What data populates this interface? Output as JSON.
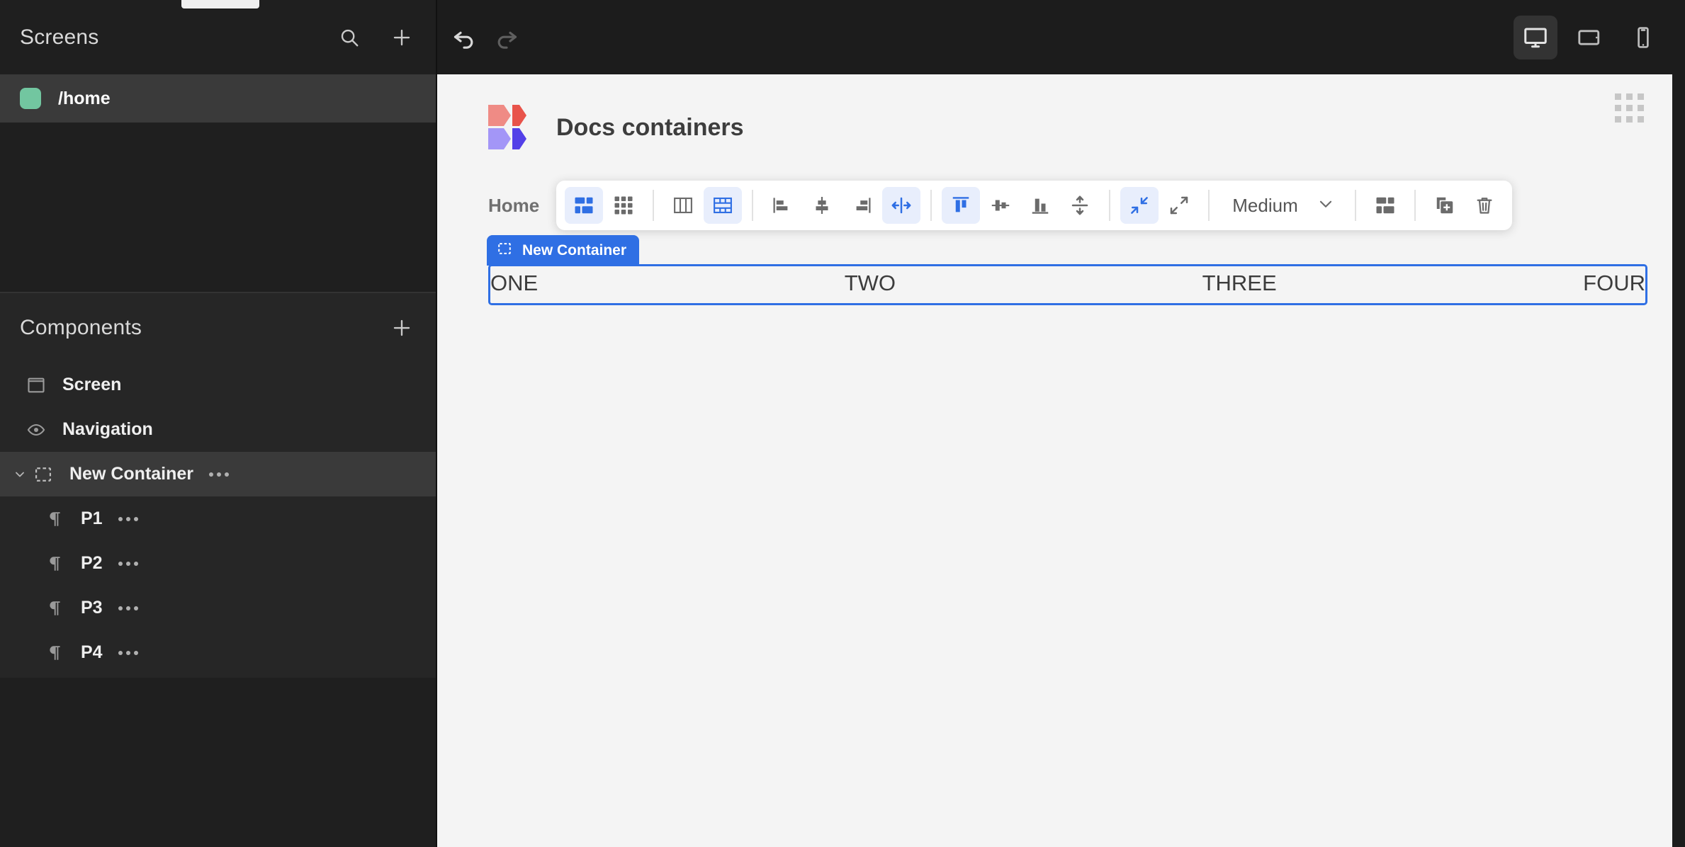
{
  "sidebar": {
    "screens_panel": {
      "title": "Screens",
      "search_icon": "search-icon",
      "add_icon": "plus-icon",
      "items": [
        {
          "label": "/home",
          "dot_color": "#72c6a0",
          "selected": true
        }
      ]
    },
    "components_panel": {
      "title": "Components",
      "add_icon": "plus-icon",
      "tree": [
        {
          "label": "Screen",
          "icon": "screen-icon",
          "level": 0,
          "selected": false,
          "has_menu": false,
          "has_chevron": false
        },
        {
          "label": "Navigation",
          "icon": "eye-icon",
          "level": 0,
          "selected": false,
          "has_menu": false,
          "has_chevron": false
        },
        {
          "label": "New Container",
          "icon": "container-icon",
          "level": 0,
          "selected": true,
          "has_menu": true,
          "has_chevron": true
        },
        {
          "label": "P1",
          "icon": "paragraph-icon",
          "level": 1,
          "selected": false,
          "has_menu": true,
          "has_chevron": false
        },
        {
          "label": "P2",
          "icon": "paragraph-icon",
          "level": 1,
          "selected": false,
          "has_menu": true,
          "has_chevron": false
        },
        {
          "label": "P3",
          "icon": "paragraph-icon",
          "level": 1,
          "selected": false,
          "has_menu": true,
          "has_chevron": false
        },
        {
          "label": "P4",
          "icon": "paragraph-icon",
          "level": 1,
          "selected": false,
          "has_menu": true,
          "has_chevron": false
        }
      ]
    }
  },
  "topbar": {
    "undo_icon": "undo-icon",
    "redo_icon": "redo-icon",
    "undo_enabled": true,
    "redo_enabled": false,
    "devices": [
      {
        "name": "desktop-view-button",
        "icon": "desktop-icon",
        "active": true
      },
      {
        "name": "tablet-view-button",
        "icon": "tablet-icon",
        "active": false
      },
      {
        "name": "mobile-view-button",
        "icon": "mobile-icon",
        "active": false
      }
    ]
  },
  "canvas": {
    "app_title": "Docs containers",
    "logo_colors": {
      "top_left": "#ef8b85",
      "top_right": "#e8534a",
      "bottom_left": "#a396f7",
      "bottom_right": "#5340e8"
    },
    "grid_handle_icon": "grid-dots-icon",
    "breadcrumb": "Home",
    "selection": {
      "badge_label": "New Container",
      "badge_icon": "container-icon",
      "accent_color": "#2f6fe4",
      "items": [
        "ONE",
        "TWO",
        "THREE",
        "FOUR"
      ]
    }
  },
  "toolbar": {
    "accent_color": "#2f6fe4",
    "active_bg": "#e8eefc",
    "size_select": {
      "label": "Medium",
      "chevron_icon": "chevron-down-icon"
    },
    "buttons": [
      {
        "name": "layout-flex-button",
        "icon": "flex-layout-icon",
        "active": true
      },
      {
        "name": "layout-grid-button",
        "icon": "grid-layout-icon",
        "active": false
      },
      {
        "name": "direction-column-button",
        "icon": "column-direction-icon",
        "active": false
      },
      {
        "name": "direction-row-button",
        "icon": "row-direction-icon",
        "active": true
      },
      {
        "name": "justify-start-button",
        "icon": "align-left-icon",
        "active": false
      },
      {
        "name": "justify-center-button",
        "icon": "align-center-horizontal-icon",
        "active": false
      },
      {
        "name": "justify-end-button",
        "icon": "align-right-icon",
        "active": false
      },
      {
        "name": "justify-space-between-button",
        "icon": "space-between-icon",
        "active": true
      },
      {
        "name": "align-top-button",
        "icon": "align-top-icon",
        "active": true
      },
      {
        "name": "align-middle-button",
        "icon": "align-middle-icon",
        "active": false
      },
      {
        "name": "align-bottom-button",
        "icon": "align-bottom-icon",
        "active": false
      },
      {
        "name": "align-stretch-button",
        "icon": "stretch-vertical-icon",
        "active": false
      },
      {
        "name": "shrink-button",
        "icon": "shrink-icon",
        "active": true
      },
      {
        "name": "grow-button",
        "icon": "expand-icon",
        "active": false
      },
      {
        "name": "component-layout-button",
        "icon": "layout-blocks-icon",
        "active": false
      },
      {
        "name": "duplicate-button",
        "icon": "duplicate-icon",
        "active": false
      },
      {
        "name": "delete-button",
        "icon": "trash-icon",
        "active": false
      }
    ]
  }
}
